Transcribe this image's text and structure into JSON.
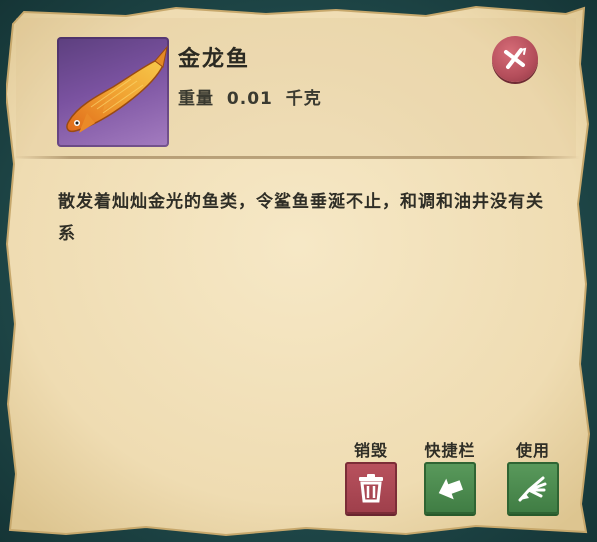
{
  "item": {
    "name": "金龙鱼",
    "weight_label": "重量",
    "weight_value": "0.01",
    "weight_unit": "千克",
    "description": "散发着灿灿金光的鱼类，令鲨鱼垂涎不止，和调和油井没有关系",
    "image_icon": "golden-arowana-fish-icon"
  },
  "actions": [
    {
      "label": "销毁",
      "icon": "trash-icon",
      "color": "#b44e5b"
    },
    {
      "label": "快捷栏",
      "icon": "arrow-left-icon",
      "color": "#4c8d50"
    },
    {
      "label": "使用",
      "icon": "hand-use-icon",
      "color": "#4c8d50"
    }
  ],
  "colors": {
    "parchment": "#f1e2bd",
    "frame_background": "#1f4a4c",
    "close_button": "#c25b67"
  }
}
